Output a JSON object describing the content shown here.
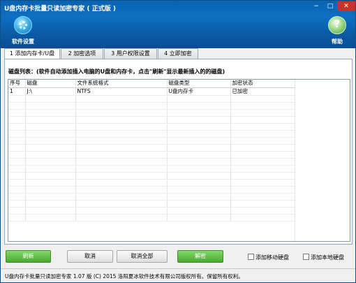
{
  "window": {
    "title": "U盘内存卡批量只读加密专家 ( 正式版 )",
    "controls": {
      "minimize": "−",
      "maximize": "□",
      "close": "✕"
    }
  },
  "toolbar": {
    "settings": {
      "label": "软件设置",
      "icon": "gear-icon"
    },
    "help": {
      "label": "帮助",
      "icon": "help-icon"
    }
  },
  "tabs": [
    {
      "label": "1 添加内存卡/U盘",
      "active": true
    },
    {
      "label": "2 加密选项",
      "active": false
    },
    {
      "label": "3 用户权限设置",
      "active": false
    },
    {
      "label": "4 立即加密",
      "active": false
    }
  ],
  "disk_list": {
    "caption": "磁盘列表：(软件自动添加插入电脑的U盘和内存卡，点击\"刷新\"显示最新插入的的磁盘)",
    "columns": [
      "序号",
      "磁盘",
      "文件系统格式",
      "磁盘类型",
      "加密状态"
    ],
    "rows": [
      [
        "1",
        "J:\\",
        "NTFS",
        "U盘内存卡",
        "已加密"
      ]
    ]
  },
  "buttons": {
    "refresh": "刷新",
    "cancel": "取消",
    "cancel_all": "取消全部",
    "decrypt": "解密"
  },
  "checkboxes": {
    "add_mobile_disk": {
      "label": "添加移动硬盘",
      "checked": false
    },
    "add_local_disk": {
      "label": "添加本地硬盘",
      "checked": false
    }
  },
  "status": {
    "text": "U盘内存卡批量只读加密专家 1.07 版  (C)  2015 洛阳夏冰软件技术有限公司版权所有。保留所有权利。"
  },
  "colors": {
    "header": "#0e6fc2",
    "green_button": "#4aa92f",
    "close_button": "#c5342b"
  }
}
